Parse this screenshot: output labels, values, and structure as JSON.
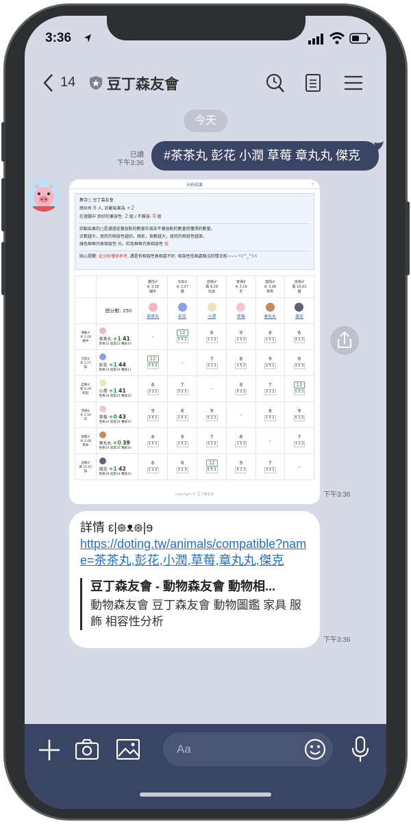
{
  "status_bar": {
    "time": "3:36"
  },
  "header": {
    "back_count": "14",
    "chat_title": "豆丁森友會"
  },
  "chat": {
    "date_label": "今天",
    "outgoing": {
      "read_label": "已讀",
      "time": "下午3:36",
      "text": "#茶茶丸 彭花 小潤 草莓 章丸丸 傑克"
    },
    "image_time": "下午3:36",
    "link_time": "下午3:36"
  },
  "result_image": {
    "tab_title": "分析結果",
    "summary": {
      "line1": "集合▢ 豆丁森友會",
      "line2_pre": "總共有 ",
      "line2_n": "6",
      "line2_mid": " 人, 診斷結果為 ",
      "line2_score": "+2",
      "line3_pre": "在遊戲中 良好的兼容性: ",
      "line3_good": "2",
      "line3_mid": " 組 / 不兼容: ",
      "line3_bad": "0",
      "line3_post": " 組",
      "desc1": "診斷結果的▢是通過從兼容對的數量中減去不兼容對的數量而獲得的數量。",
      "desc2": "正數越大，居民的相容性越好。相反，負數越大，居民的相容性越差。",
      "desc3_pre": "綠色框框代表相容性 ",
      "desc3_high": "高",
      "desc3_mid": "。紅色框框代表相容性 ",
      "desc3_low": "低",
      "note_pre": "貼心提醒: ",
      "note_red": "此分析僅供參考",
      "note_post": ", 遇是有相容性高相處不好, 相容性低相處融洽的情況啦~~~ヾ(^_^)ゞ"
    },
    "total_label": "總分數: 250",
    "columns": [
      {
        "info": "雄性♂\n水 3.18\n緒中",
        "name": "茶茶丸"
      },
      {
        "info": "元氣♀\n水 2.27\n猫",
        "name": "彭花"
      },
      {
        "info": "自戀♂\n風 9.29\n松鼠",
        "name": "小潤"
      },
      {
        "info": "普通♀\n水 3.19\n羊",
        "name": "草莓"
      },
      {
        "info": "悠閒♂\n水 3.08\n章魚",
        "name": "章丸丸"
      },
      {
        "info": "自戀♂\n風 10.01\n猫",
        "name": "傑克"
      }
    ],
    "rows": [
      {
        "info": "運動♂\n水 3.18\n緒中",
        "name": "茶茶丸",
        "score": "+1",
        "total": "41",
        "sub": "性格12 星座13 種族10",
        "cells": [
          {
            "v": "-",
            "c": ""
          },
          {
            "v": "12",
            "c": "5 5 2",
            "box": true
          },
          {
            "v": "6",
            "c": "2 2 2"
          },
          {
            "v": "9",
            "c": "2 5 2"
          },
          {
            "v": "8",
            "c": "1 5 2"
          },
          {
            "v": "6",
            "c": "2 2 2"
          }
        ]
      },
      {
        "info": "元氣♀\n水 2.27\n猫",
        "name": "彭花",
        "score": "+1",
        "total": "44",
        "sub": "性格14 星座19 種族11",
        "cells": [
          {
            "v": "12",
            "c": "5 5 2",
            "box": true
          },
          {
            "v": "-",
            "c": ""
          },
          {
            "v": "7",
            "c": "3 2 2"
          },
          {
            "v": "8",
            "c": "1 5 2"
          },
          {
            "v": "9",
            "c": "2 5 2"
          },
          {
            "v": "8",
            "c": "3 2 3"
          }
        ]
      },
      {
        "info": "自戀♂\n風 9.29\n松鼠",
        "name": "小潤",
        "score": "+1",
        "total": "41",
        "sub": "性格18 星座13 種族10",
        "cells": [
          {
            "v": "6",
            "c": "2 2 2"
          },
          {
            "v": "7",
            "c": "3 2 2"
          },
          {
            "v": "-",
            "c": ""
          },
          {
            "v": "9",
            "c": "5 2 2"
          },
          {
            "v": "7",
            "c": "3 2 2"
          },
          {
            "v": "12",
            "c": "5 5 2",
            "box": true
          }
        ]
      },
      {
        "info": "普通♀\n水 3.19\n羊",
        "name": "草莓",
        "score": "+0",
        "total": "43",
        "sub": "性格14 星座19 種族10",
        "cells": [
          {
            "v": "9",
            "c": "2 5 2"
          },
          {
            "v": "8",
            "c": "1 5 2"
          },
          {
            "v": "9",
            "c": "5 2 2"
          },
          {
            "v": "-",
            "c": ""
          },
          {
            "v": "8",
            "c": "1 5 2"
          },
          {
            "v": "9",
            "c": "5 2 2"
          }
        ]
      },
      {
        "info": "悠閒♂\n水 3.08\n章魚",
        "name": "章丸丸",
        "score": "+0",
        "total": "39",
        "sub": "性格14 星座15 種族10",
        "cells": [
          {
            "v": "8",
            "c": "1 5 2"
          },
          {
            "v": "9",
            "c": "2 5 2"
          },
          {
            "v": "7",
            "c": "3 2 2"
          },
          {
            "v": "8",
            "c": "1 5 2"
          },
          {
            "v": "-",
            "c": ""
          },
          {
            "v": "7",
            "c": "3 2 2"
          }
        ]
      },
      {
        "info": "自戀♂\n風 10.01\n猫",
        "name": "傑克",
        "score": "+1",
        "total": "42",
        "sub": "性格18 星座14 種族10",
        "cells": [
          {
            "v": "6",
            "c": "2 2 2"
          },
          {
            "v": "8",
            "c": "3 2 3"
          },
          {
            "v": "12",
            "c": "5 5 2",
            "box": true
          },
          {
            "v": "9",
            "c": "5 2 2"
          },
          {
            "v": "7",
            "c": "3 2 2"
          },
          {
            "v": "-",
            "c": ""
          }
        ]
      }
    ],
    "copyright": "copyright © 豆丁森友會"
  },
  "link_message": {
    "prefix": "詳情 ",
    "emoticon": "ԑ|᪥ᴥ᪥|ɘ",
    "url": "https://doting.tw/animals/compatible?name=茶茶丸,彭花,小潤,草莓,章丸丸,傑克",
    "preview_title": "豆丁森友會 - 動物森友會 動物相...",
    "preview_desc": "動物森友會 豆丁森友會 動物圖鑑 家具 服飾 相容性分析"
  },
  "composer": {
    "placeholder": "Aa"
  },
  "colors": {
    "accent": "#3a4566",
    "green": "#2e9a3a",
    "red": "#d23b3b",
    "link": "#1f6fd6"
  }
}
